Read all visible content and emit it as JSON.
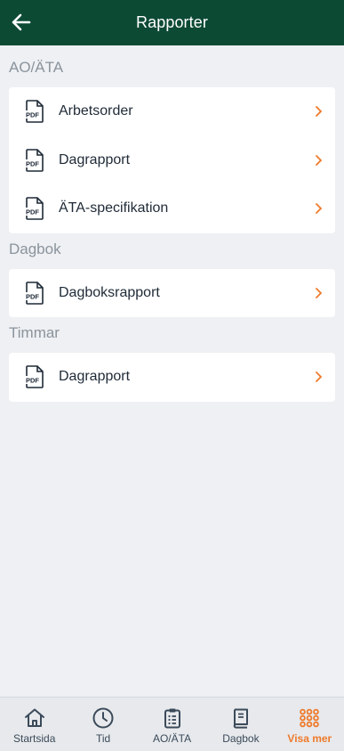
{
  "header": {
    "title": "Rapporter",
    "back_icon": "arrow-left-icon"
  },
  "colors": {
    "header_bg": "#0d4a34",
    "accent": "#ef7a2b",
    "page_bg": "#eef0f3"
  },
  "sections": [
    {
      "title": "AO/ÄTA",
      "items": [
        "Arbetsorder",
        "Dagrapport",
        "ÄTA-specifikation"
      ]
    },
    {
      "title": "Dagbok",
      "items": [
        "Dagboksrapport"
      ]
    },
    {
      "title": "Timmar",
      "items": [
        "Dagrapport"
      ]
    }
  ],
  "pdf_icon_text": "PDF",
  "tabbar": {
    "active_index": 4,
    "tabs": [
      {
        "label": "Startsida",
        "icon": "home-icon"
      },
      {
        "label": "Tid",
        "icon": "clock-icon"
      },
      {
        "label": "AO/ÄTA",
        "icon": "clipboard-list-icon"
      },
      {
        "label": "Dagbok",
        "icon": "book-icon"
      },
      {
        "label": "Visa mer",
        "icon": "grid-dots-icon"
      }
    ]
  }
}
